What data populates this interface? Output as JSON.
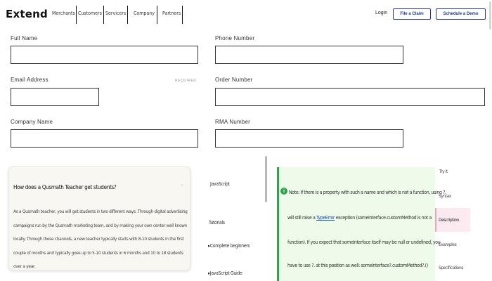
{
  "header": {
    "logo": "Extend",
    "nav": [
      "Merchants",
      "Customers",
      "Servicers",
      "Company",
      "Partners"
    ],
    "login": "Login",
    "file_claim": "File a Claim",
    "schedule_demo": "Schedule a Demo"
  },
  "form": {
    "full_name": {
      "label": "Full Name",
      "value": ""
    },
    "phone_number": {
      "label": "Phone Number",
      "value": ""
    },
    "email": {
      "label": "Email Address",
      "required": "REQUIRED",
      "value": ""
    },
    "order_number": {
      "label": "Order Number",
      "value": ""
    },
    "company_name": {
      "label": "Company Name",
      "value": ""
    },
    "rma_number": {
      "label": "RMA Number",
      "value": ""
    }
  },
  "faq": {
    "question": "How does a Qusmath Teacher get students?",
    "toggle": "–",
    "answer": "As a Qusmath teacher, you will get students in two different ways. Through digital advertising campaigns run by the Qusmath marketing team, and by making your own center well known locally. Through these channels, a new teacher typically starts with 8-10 students in the first couple of months and typically goes up to 5-10 students in 6 months and 10 to 18 students over a year."
  },
  "sidebar": {
    "items": [
      "JavaScript",
      "Tutorials",
      "Complete beginners",
      "JavaScript Guide"
    ]
  },
  "note": {
    "icon": "i",
    "lines": [
      {
        "pre": "Note: If there is a property with such a name and which is not a function, using ?.",
        "link": "",
        "post": ""
      },
      {
        "pre": "will still raise a ",
        "link": "TypeError",
        "post": " exception (someInterface.customMethod is not a"
      },
      {
        "pre": "function). If you expect that someInterface itself may be null or undefined, you",
        "link": "",
        "post": ""
      },
      {
        "pre": "have to use ?. at this position as well: someInterface?.customMethod?.()",
        "link": "",
        "post": ""
      }
    ]
  },
  "toc": {
    "items": [
      "Try it",
      "Syntax",
      "Description",
      "Examples",
      "Specifications"
    ],
    "active": "Description"
  },
  "colors": {
    "brand_blue": "#1f3a8a",
    "note_green": "#2aa54a",
    "toc_active": "#fbeaf0"
  }
}
